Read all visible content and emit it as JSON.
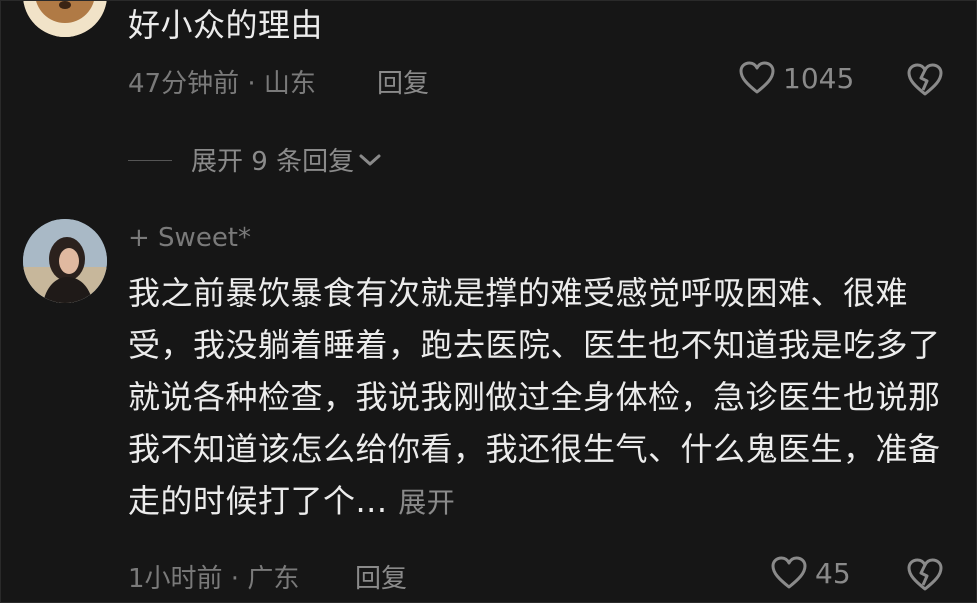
{
  "comments": [
    {
      "text": "好小众的理由",
      "meta": "47分钟前 · 山东",
      "reply_label": "回复",
      "likes": "1045",
      "expand_replies": "展开 9 条回复"
    },
    {
      "username": "+ Sweet*",
      "text": "我之前暴饮暴食有次就是撑的难受感觉呼吸困难、很难受，我没躺着睡着，跑去医院、医生也不知道我是吃多了就说各种检查，我说我刚做过全身体检，急诊医生也说那我不知道该怎么给你看，我还很生气、什么鬼医生，准备走的时候打了个...",
      "more_label": "展开",
      "meta": "1小时前 · 广东",
      "reply_label": "回复",
      "likes": "45"
    }
  ],
  "icons": {
    "like": "heart-outline-icon",
    "dislike": "broken-heart-icon",
    "expand": "chevron-down-icon"
  }
}
